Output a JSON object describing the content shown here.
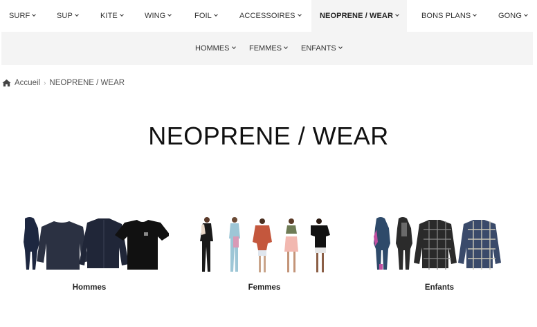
{
  "topnav": {
    "items": [
      {
        "label": "SURF"
      },
      {
        "label": "SUP"
      },
      {
        "label": "KITE"
      },
      {
        "label": "WING"
      },
      {
        "label": "FOIL"
      },
      {
        "label": "ACCESSOIRES"
      },
      {
        "label": "NEOPRENE / WEAR"
      },
      {
        "label": "BONS PLANS"
      },
      {
        "label": "GONG"
      }
    ]
  },
  "subnav": {
    "items": [
      {
        "label": "HOMMES"
      },
      {
        "label": "FEMMES"
      },
      {
        "label": "ENFANTS"
      }
    ]
  },
  "breadcrumb": {
    "home": "Accueil",
    "current": "NEOPRENE / WEAR"
  },
  "page": {
    "title": "NEOPRENE / WEAR"
  },
  "categories": [
    {
      "label": "Hommes"
    },
    {
      "label": "Femmes"
    },
    {
      "label": "Enfants"
    }
  ]
}
